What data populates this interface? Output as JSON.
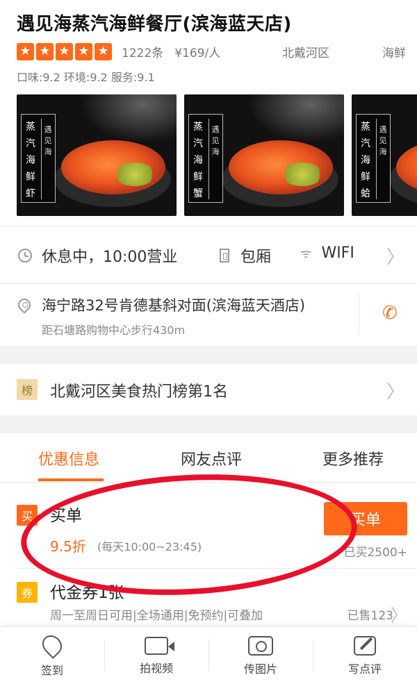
{
  "header": {
    "title": "遇见海蒸汽海鲜餐厅(滨海蓝天店)",
    "stars": 5,
    "star_glyph": "★",
    "review_count": "1222条",
    "avg_price": "¥169/人",
    "region": "北戴河区",
    "category": "海鲜",
    "scores": "口味:9.2 环境:9.2 服务:9.1"
  },
  "gallery": [
    {
      "tag_main": "蒸汽海鲜虾",
      "tag_sub": "遇见海"
    },
    {
      "tag_main": "蒸汽海鲜蟹",
      "tag_sub": "遇见海"
    },
    {
      "tag_main": "蒸汽海鲜蛤",
      "tag_sub": "遇见海"
    }
  ],
  "info": {
    "hours": "休息中，10:00营业",
    "room": "包厢",
    "wifi": "WIFI",
    "wifi_glyph": "ᯤ",
    "chevron": "〉"
  },
  "address": {
    "main": "海宁路32号肯德基斜对面(滨海蓝天酒店)",
    "sub": "距石塘路购物中心步行430m",
    "phone_glyph": "✆"
  },
  "ranking": {
    "badge": "榜",
    "text": "北戴河区美食热门榜第1名",
    "chevron": "〉"
  },
  "tabs": [
    "优惠信息",
    "网友点评",
    "更多推荐"
  ],
  "deal": {
    "badge": "买",
    "title": "买单",
    "discount": "9.5折",
    "hours": "(每天10:00~23:45)",
    "button": "买单",
    "sold": "已买2500+"
  },
  "voucher": {
    "badge": "券",
    "title": "代金券1张",
    "desc": "周一至周日可用|全场通用|免预约|可叠加",
    "sold": "已售123",
    "chevron": "〉"
  },
  "bottom_bar": [
    {
      "label": "签到",
      "icon": "checkin-icon"
    },
    {
      "label": "拍视频",
      "icon": "video-icon"
    },
    {
      "label": "传图片",
      "icon": "photo-icon"
    },
    {
      "label": "写点评",
      "icon": "review-icon"
    }
  ],
  "colors": {
    "accent": "#ff6a1a",
    "annotation": "#e8102a"
  }
}
